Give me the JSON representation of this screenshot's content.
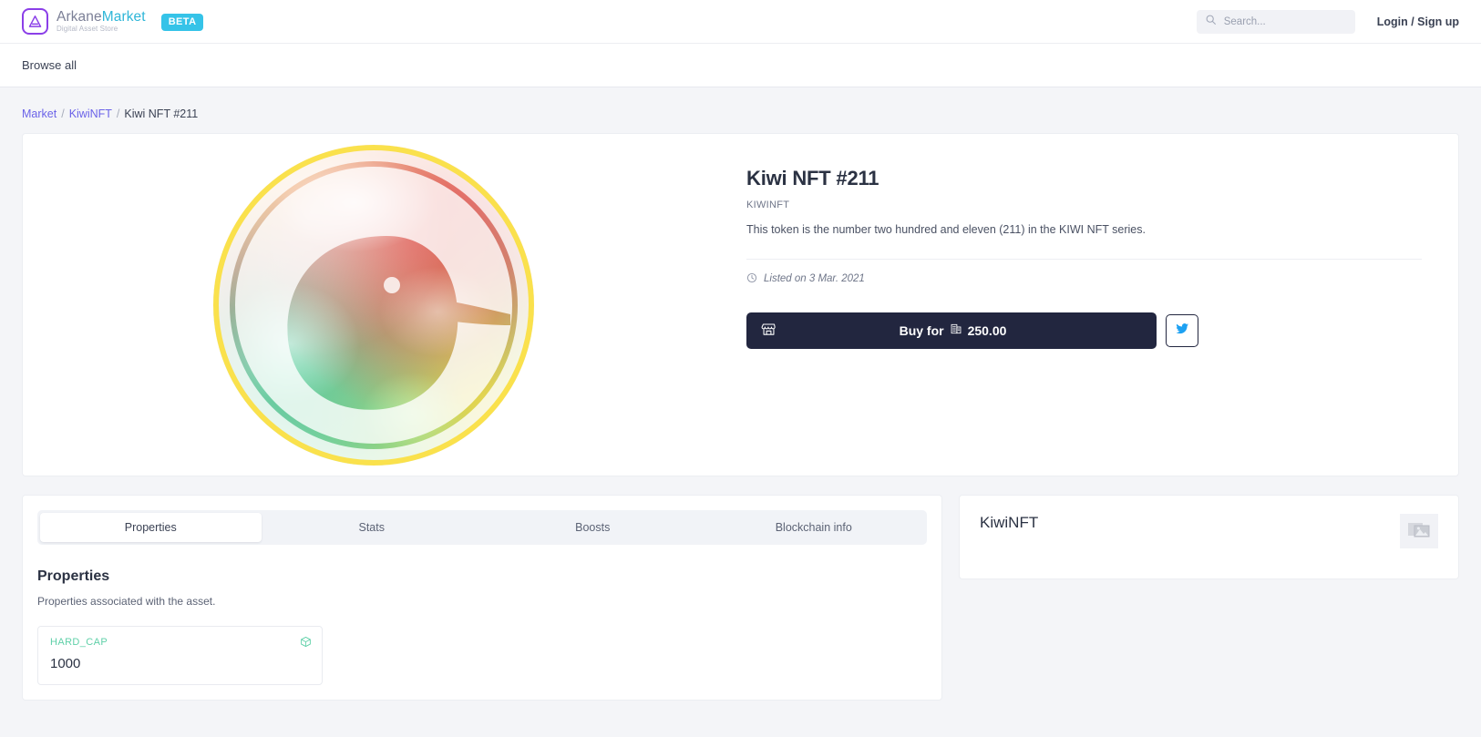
{
  "header": {
    "brand_word1": "Arkane",
    "brand_word2": "Market",
    "brand_subtitle": "Digital Asset Store",
    "beta_badge": "BETA",
    "search_placeholder": "Search...",
    "search_value": "",
    "login_label": "Login / Sign up"
  },
  "subnav": {
    "browse_all": "Browse all"
  },
  "breadcrumb": {
    "root": "Market",
    "collection": "KiwiNFT",
    "current": "Kiwi NFT #211",
    "separator": "/"
  },
  "asset": {
    "title": "Kiwi NFT #211",
    "collection": "KIWINFT",
    "description": "This token is the number two hundred and eleven (211) in the KIWI NFT series.",
    "listed_label": "Listed on 3 Mar. 2021",
    "buy_label": "Buy for",
    "price": "250.00",
    "currency_symbol": "≡"
  },
  "tabs": [
    {
      "label": "Properties",
      "active": true
    },
    {
      "label": "Stats",
      "active": false
    },
    {
      "label": "Boosts",
      "active": false
    },
    {
      "label": "Blockchain info",
      "active": false
    }
  ],
  "properties_panel": {
    "title": "Properties",
    "subtitle": "Properties associated with the asset.",
    "items": [
      {
        "key": "HARD_CAP",
        "value": "1000"
      }
    ]
  },
  "collection_panel": {
    "name": "KiwiNFT"
  },
  "colors": {
    "accent_purple": "#6b63e8",
    "brand_cyan": "#35c3e8",
    "brand_gray": "#7b7f96",
    "dark_navy": "#22263f",
    "property_green": "#5fd0a8",
    "page_bg": "#f4f5f8",
    "twitter_blue": "#1da1f2"
  }
}
